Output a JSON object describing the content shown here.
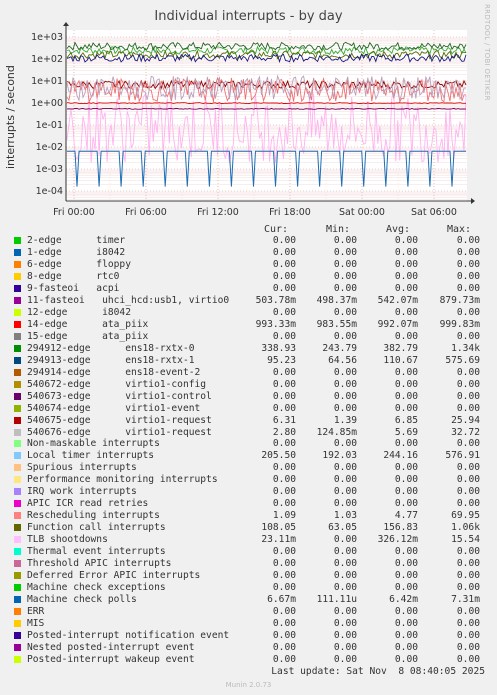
{
  "title": "Individual interrupts - by day",
  "side_text": "RRDTOOL / TOBI OETIKER",
  "ylabel": "interrupts / second",
  "headers": {
    "cur": "Cur:",
    "min": "Min:",
    "avg": "Avg:",
    "max": "Max:"
  },
  "footer": "Last update: Sat Nov  8 08:40:05 2025",
  "munin": "Munin 2.0.73",
  "chart_data": {
    "type": "line",
    "yscale": "log",
    "ylim": [
      5e-05,
      2000
    ],
    "yticks": [
      "1e+03",
      "1e+02",
      "1e+01",
      "1e+00",
      "1e-01",
      "1e-02",
      "1e-03",
      "1e-04"
    ],
    "xticks": [
      "Fri 00:00",
      "Fri 06:00",
      "Fri 12:00",
      "Fri 18:00",
      "Sat 00:00",
      "Sat 06:00"
    ],
    "grid": true,
    "series": [
      {
        "name": "Local timer interrupts",
        "color": "#33aa33",
        "level": 244.16
      },
      {
        "name": "294912-edge ens18-rxtx-0",
        "color": "#226622",
        "level": 382.79
      },
      {
        "name": "Function call interrupts",
        "color": "#556b00",
        "level": 156.83
      },
      {
        "name": "294913-edge ens18-rxtx-1",
        "color": "#1a1a80",
        "level": 110.67
      },
      {
        "name": "540675-edge virtio1-request",
        "color": "#8b0000",
        "level": 6.85
      },
      {
        "name": "TLB shootdowns",
        "color": "#ffb3f0",
        "level": 0.326
      },
      {
        "name": "Rescheduling interrupts",
        "color": "#f07070",
        "level": 4.77
      },
      {
        "name": "540676-edge virtio1-request",
        "color": "#bba0bb",
        "level": 5.69
      },
      {
        "name": "14-edge ata_piix",
        "color": "#e00000",
        "level": 0.992
      },
      {
        "name": "11-fasteoi uhci_hcd:usb1, virtio0",
        "color": "#7a005a",
        "level": 0.542
      },
      {
        "name": "Machine check polls",
        "color": "#1e6fb5",
        "level": 0.00642
      }
    ]
  },
  "legend": [
    {
      "color": "#00cc00",
      "label": "2-edge      timer",
      "cur": "0.00",
      "min": "0.00",
      "avg": "0.00",
      "max": "0.00"
    },
    {
      "color": "#0066b3",
      "label": "1-edge      i8042",
      "cur": "0.00",
      "min": "0.00",
      "avg": "0.00",
      "max": "0.00"
    },
    {
      "color": "#ff8000",
      "label": "6-edge      floppy",
      "cur": "0.00",
      "min": "0.00",
      "avg": "0.00",
      "max": "0.00"
    },
    {
      "color": "#ffcc00",
      "label": "8-edge      rtc0",
      "cur": "0.00",
      "min": "0.00",
      "avg": "0.00",
      "max": "0.00"
    },
    {
      "color": "#330099",
      "label": "9-fasteoi   acpi",
      "cur": "0.00",
      "min": "0.00",
      "avg": "0.00",
      "max": "0.00"
    },
    {
      "color": "#990099",
      "label": "11-fasteoi   uhci_hcd:usb1, virtio0",
      "cur": "503.78m",
      "min": "498.37m",
      "avg": "542.07m",
      "max": "879.73m"
    },
    {
      "color": "#ccff00",
      "label": "12-edge      i8042",
      "cur": "0.00",
      "min": "0.00",
      "avg": "0.00",
      "max": "0.00"
    },
    {
      "color": "#ff0000",
      "label": "14-edge      ata_piix",
      "cur": "993.33m",
      "min": "983.55m",
      "avg": "992.07m",
      "max": "999.83m"
    },
    {
      "color": "#808080",
      "label": "15-edge      ata_piix",
      "cur": "0.00",
      "min": "0.00",
      "avg": "0.00",
      "max": "0.00"
    },
    {
      "color": "#008f00",
      "label": "294912-edge      ens18-rxtx-0",
      "cur": "338.93",
      "min": "243.79",
      "avg": "382.79",
      "max": "1.34k"
    },
    {
      "color": "#00487d",
      "label": "294913-edge      ens18-rxtx-1",
      "cur": "95.23",
      "min": "64.56",
      "avg": "110.67",
      "max": "575.69"
    },
    {
      "color": "#b35a00",
      "label": "294914-edge      ens18-event-2",
      "cur": "0.00",
      "min": "0.00",
      "avg": "0.00",
      "max": "0.00"
    },
    {
      "color": "#b38f00",
      "label": "540672-edge      virtio1-config",
      "cur": "0.00",
      "min": "0.00",
      "avg": "0.00",
      "max": "0.00"
    },
    {
      "color": "#6b006b",
      "label": "540673-edge      virtio1-control",
      "cur": "0.00",
      "min": "0.00",
      "avg": "0.00",
      "max": "0.00"
    },
    {
      "color": "#8fb300",
      "label": "540674-edge      virtio1-event",
      "cur": "0.00",
      "min": "0.00",
      "avg": "0.00",
      "max": "0.00"
    },
    {
      "color": "#b30000",
      "label": "540675-edge      virtio1-request",
      "cur": "6.31",
      "min": "1.39",
      "avg": "6.85",
      "max": "25.94"
    },
    {
      "color": "#bebebe",
      "label": "540676-edge      virtio1-request",
      "cur": "2.80",
      "min": "124.85m",
      "avg": "5.69",
      "max": "32.72"
    },
    {
      "color": "#80ff80",
      "label": "Non-maskable interrupts",
      "cur": "0.00",
      "min": "0.00",
      "avg": "0.00",
      "max": "0.00"
    },
    {
      "color": "#80c9ff",
      "label": "Local timer interrupts",
      "cur": "205.50",
      "min": "192.03",
      "avg": "244.16",
      "max": "576.91"
    },
    {
      "color": "#ffc080",
      "label": "Spurious interrupts",
      "cur": "0.00",
      "min": "0.00",
      "avg": "0.00",
      "max": "0.00"
    },
    {
      "color": "#ffe680",
      "label": "Performance monitoring interrupts",
      "cur": "0.00",
      "min": "0.00",
      "avg": "0.00",
      "max": "0.00"
    },
    {
      "color": "#aa80ff",
      "label": "IRQ work interrupts",
      "cur": "0.00",
      "min": "0.00",
      "avg": "0.00",
      "max": "0.00"
    },
    {
      "color": "#ee00cc",
      "label": "APIC ICR read retries",
      "cur": "0.00",
      "min": "0.00",
      "avg": "0.00",
      "max": "0.00"
    },
    {
      "color": "#ff8080",
      "label": "Rescheduling interrupts",
      "cur": "1.09",
      "min": "1.03",
      "avg": "4.77",
      "max": "69.95"
    },
    {
      "color": "#666600",
      "label": "Function call interrupts",
      "cur": "108.05",
      "min": "63.05",
      "avg": "156.83",
      "max": "1.06k"
    },
    {
      "color": "#ffbfff",
      "label": "TLB shootdowns",
      "cur": "23.11m",
      "min": "0.00",
      "avg": "326.12m",
      "max": "15.54"
    },
    {
      "color": "#00ffcc",
      "label": "Thermal event interrupts",
      "cur": "0.00",
      "min": "0.00",
      "avg": "0.00",
      "max": "0.00"
    },
    {
      "color": "#cc6699",
      "label": "Threshold APIC interrupts",
      "cur": "0.00",
      "min": "0.00",
      "avg": "0.00",
      "max": "0.00"
    },
    {
      "color": "#999900",
      "label": "Deferred Error APIC interrupts",
      "cur": "0.00",
      "min": "0.00",
      "avg": "0.00",
      "max": "0.00"
    },
    {
      "color": "#00cc00",
      "label": "Machine check exceptions",
      "cur": "0.00",
      "min": "0.00",
      "avg": "0.00",
      "max": "0.00"
    },
    {
      "color": "#0066b3",
      "label": "Machine check polls",
      "cur": "6.67m",
      "min": "111.11u",
      "avg": "6.42m",
      "max": "7.31m"
    },
    {
      "color": "#ff8000",
      "label": "ERR",
      "cur": "0.00",
      "min": "0.00",
      "avg": "0.00",
      "max": "0.00"
    },
    {
      "color": "#ffcc00",
      "label": "MIS",
      "cur": "0.00",
      "min": "0.00",
      "avg": "0.00",
      "max": "0.00"
    },
    {
      "color": "#330099",
      "label": "Posted-interrupt notification event",
      "cur": "0.00",
      "min": "0.00",
      "avg": "0.00",
      "max": "0.00"
    },
    {
      "color": "#990099",
      "label": "Nested posted-interrupt event",
      "cur": "0.00",
      "min": "0.00",
      "avg": "0.00",
      "max": "0.00"
    },
    {
      "color": "#ccff00",
      "label": "Posted-interrupt wakeup event",
      "cur": "0.00",
      "min": "0.00",
      "avg": "0.00",
      "max": "0.00"
    }
  ]
}
